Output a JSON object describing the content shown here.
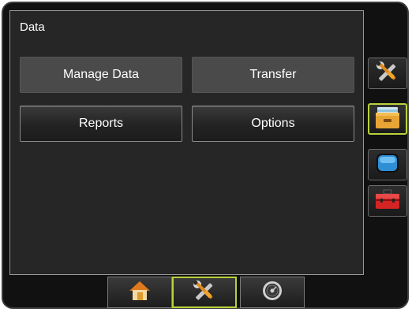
{
  "panel": {
    "title": "Data"
  },
  "buttons": {
    "manage_data": "Manage Data",
    "transfer": "Transfer",
    "reports": "Reports",
    "options": "Options"
  },
  "side_tabs": [
    {
      "icon": "wrench-screwdriver-icon",
      "active": false
    },
    {
      "icon": "folder-drawer-icon",
      "active": true
    },
    {
      "icon": "monitor-icon",
      "active": false
    },
    {
      "icon": "toolbox-icon",
      "active": false
    }
  ],
  "bottom_tabs": [
    {
      "icon": "home-icon",
      "active": false
    },
    {
      "icon": "wrench-screwdriver-icon",
      "active": true
    },
    {
      "icon": "speedometer-icon",
      "active": false
    }
  ],
  "colors": {
    "accent_active_border": "#b7d33a",
    "panel_background": "#262626",
    "button_flat": "#4a4a4a"
  }
}
